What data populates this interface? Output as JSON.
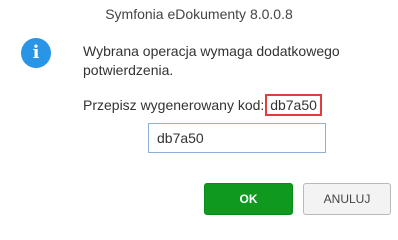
{
  "window": {
    "title": "Symfonia eDokumenty 8.0.0.8"
  },
  "message": {
    "text": "Wybrana operacja wymaga dodatkowego potwierdzenia.",
    "icon": "info-icon"
  },
  "confirmation": {
    "prompt": "Przepisz wygenerowany kod:",
    "code": "db7a50",
    "input_value": "db7a50"
  },
  "buttons": {
    "ok_label": "OK",
    "cancel_label": "ANULUJ"
  },
  "colors": {
    "info_icon": "#2a94e6",
    "ok_button": "#0f9a1f",
    "code_highlight_border": "#e23c3c"
  }
}
